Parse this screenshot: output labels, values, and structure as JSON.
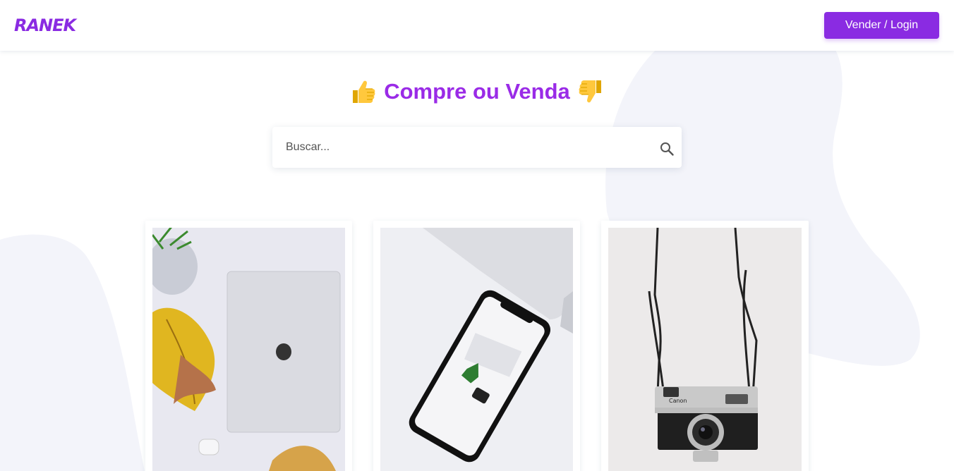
{
  "header": {
    "logo": "RANEK",
    "login_label": "Vender / Login"
  },
  "hero": {
    "title": "Compre ou Venda",
    "left_emoji": "thumbs-up",
    "right_emoji": "thumbs-down"
  },
  "search": {
    "placeholder": "Buscar...",
    "value": "",
    "icon": "search-icon"
  },
  "products": [
    {
      "image": "laptop-photo"
    },
    {
      "image": "smartphone-photo"
    },
    {
      "image": "camera-photo"
    }
  ],
  "colors": {
    "brand": "#8a2be2",
    "heading": "#9a2be7",
    "blob": "#f3f4fa"
  }
}
